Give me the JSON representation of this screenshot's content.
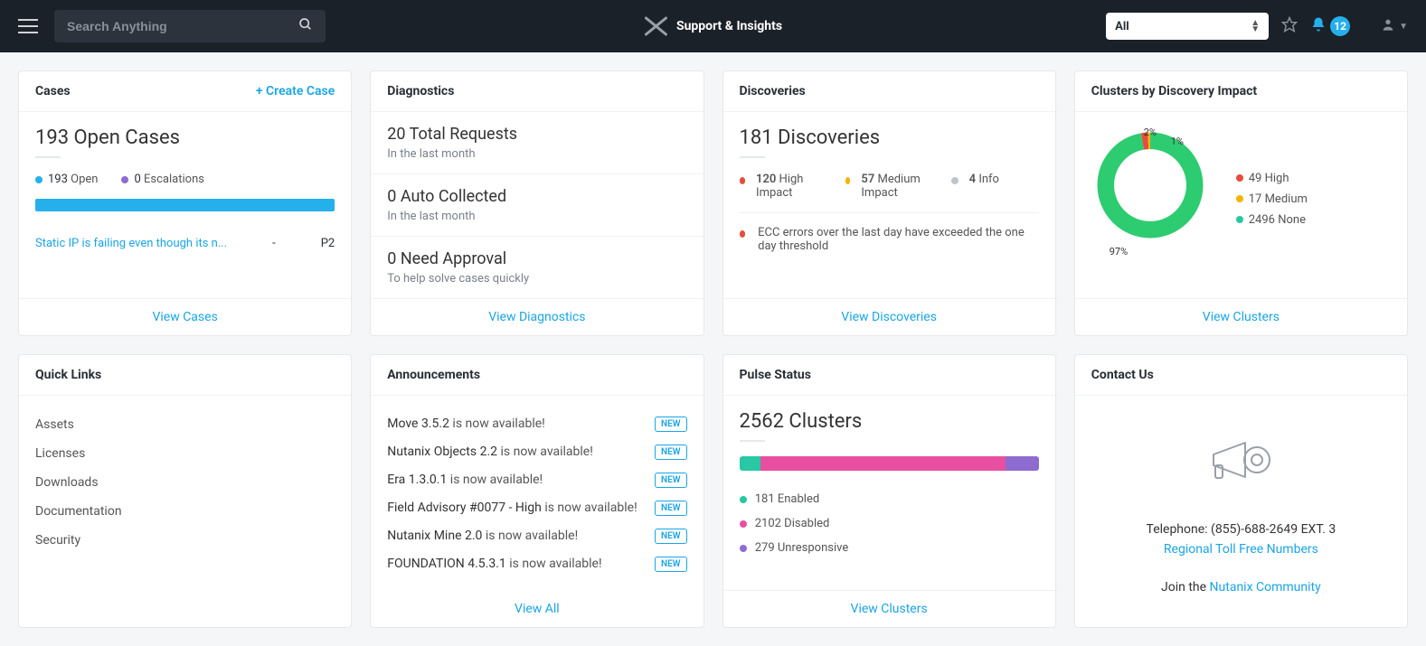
{
  "header": {
    "search_placeholder": "Search Anything",
    "app_title": "Support & Insights",
    "filter_selected": "All",
    "notification_count": "12"
  },
  "cases": {
    "title": "Cases",
    "create_label": "+ Create Case",
    "open_cases_heading": "193 Open Cases",
    "open_count": "193",
    "open_label": "Open",
    "escalations_count": "0",
    "escalations_label": "Escalations",
    "progress_pct": 100,
    "case_title": "Static IP is failing even though its n...",
    "case_status": "-",
    "case_priority": "P2",
    "view_label": "View Cases"
  },
  "diagnostics": {
    "title": "Diagnostics",
    "blocks": [
      {
        "head": "20 Total Requests",
        "sub": "In the last month"
      },
      {
        "head": "0 Auto Collected",
        "sub": "In the last month"
      },
      {
        "head": "0 Need Approval",
        "sub": "To help solve cases quickly"
      }
    ],
    "view_label": "View Diagnostics"
  },
  "discoveries": {
    "title": "Discoveries",
    "heading": "181 Discoveries",
    "stats": [
      {
        "num": "120",
        "label": "High Impact",
        "dot": "dot-red"
      },
      {
        "num": "57",
        "label": "Medium Impact",
        "dot": "dot-yellow"
      },
      {
        "num": "4",
        "label": "Info",
        "dot": "dot-gray"
      }
    ],
    "alert_text": "ECC errors over the last day have exceeded the one day threshold",
    "view_label": "View Discoveries"
  },
  "clusters_impact": {
    "title": "Clusters by Discovery Impact",
    "legend": [
      {
        "dot": "dot-red",
        "text": "49 High"
      },
      {
        "dot": "dot-yellow",
        "text": "17 Medium"
      },
      {
        "dot": "dot-teal",
        "text": "2496 None"
      }
    ],
    "pct_labels": {
      "high": "2%",
      "medium": "1%",
      "none": "97%"
    },
    "view_label": "View Clusters"
  },
  "quick_links": {
    "title": "Quick Links",
    "items": [
      "Assets",
      "Licenses",
      "Downloads",
      "Documentation",
      "Security"
    ]
  },
  "announcements": {
    "title": "Announcements",
    "items": [
      {
        "title": "Move 3.5.2",
        "suffix": " is now available!",
        "tag": "NEW"
      },
      {
        "title": "Nutanix Objects 2.2",
        "suffix": " is now available!",
        "tag": "NEW"
      },
      {
        "title": "Era 1.3.0.1",
        "suffix": " is now available!",
        "tag": "NEW"
      },
      {
        "title": "Field Advisory #0077 - High",
        "suffix": " is now available!",
        "tag": "NEW"
      },
      {
        "title": "Nutanix Mine 2.0",
        "suffix": " is now available!",
        "tag": "NEW"
      },
      {
        "title": "FOUNDATION 4.5.3.1",
        "suffix": " is now available!",
        "tag": "NEW"
      }
    ],
    "view_label": "View All"
  },
  "pulse": {
    "title": "Pulse Status",
    "heading": "2562 Clusters",
    "segments": [
      {
        "cls": "seg-teal",
        "pct": 7
      },
      {
        "cls": "seg-pink",
        "pct": 82
      },
      {
        "cls": "seg-purple",
        "pct": 11
      }
    ],
    "legend": [
      {
        "dot": "dot-teal",
        "count": "181",
        "label": "Enabled"
      },
      {
        "dot": "dot-pink",
        "count": "2102",
        "label": "Disabled"
      },
      {
        "dot": "dot-purple",
        "count": "279",
        "label": "Unresponsive"
      }
    ],
    "view_label": "View Clusters"
  },
  "contact": {
    "title": "Contact Us",
    "telephone_label": "Telephone: ",
    "telephone_value": "(855)-688-2649 EXT. 3",
    "regional_link": "Regional Toll Free Numbers",
    "join_prefix": "Join the ",
    "community_link": "Nutanix Community"
  },
  "chart_data": {
    "type": "pie",
    "title": "Clusters by Discovery Impact",
    "categories": [
      "High",
      "Medium",
      "None"
    ],
    "values": [
      49,
      17,
      2496
    ],
    "percentages": [
      2,
      1,
      97
    ],
    "colors": [
      "#e74c3c",
      "#f5b400",
      "#2ecc71"
    ]
  }
}
